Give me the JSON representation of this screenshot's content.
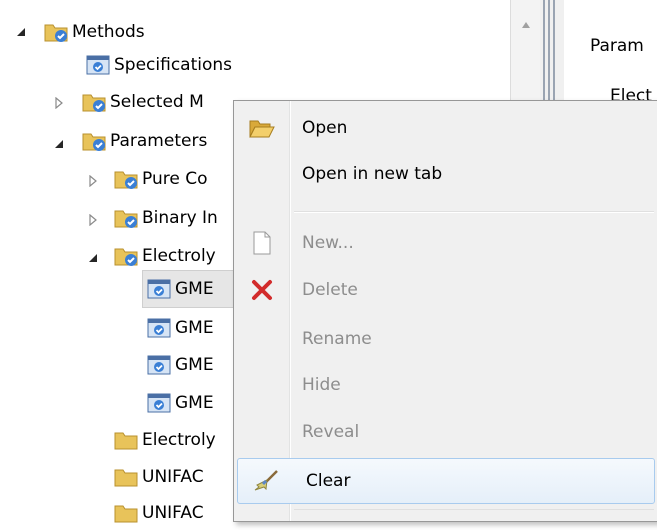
{
  "tree": {
    "items": [
      {
        "label": "Methods",
        "icon": "folder-gear-icon",
        "expander": "expanded"
      },
      {
        "label": "Specifications",
        "icon": "form-check-icon",
        "expander": "none"
      },
      {
        "label": "Selected M",
        "icon": "folder-gear-icon",
        "expander": "collapsed"
      },
      {
        "label": "Parameters",
        "icon": "folder-gear-icon",
        "expander": "expanded"
      },
      {
        "label": "Pure Co",
        "icon": "folder-gear-icon",
        "expander": "collapsed"
      },
      {
        "label": "Binary In",
        "icon": "folder-gear-icon",
        "expander": "collapsed"
      },
      {
        "label": "Electroly",
        "icon": "folder-gear-icon",
        "expander": "expanded"
      },
      {
        "label": "GME",
        "icon": "form-check-icon",
        "expander": "none"
      },
      {
        "label": "GME",
        "icon": "form-check-icon",
        "expander": "none"
      },
      {
        "label": "GME",
        "icon": "form-check-icon",
        "expander": "none"
      },
      {
        "label": "GME",
        "icon": "form-check-icon",
        "expander": "none"
      },
      {
        "label": "Electroly",
        "icon": "folder-icon",
        "expander": "none"
      },
      {
        "label": "UNIFAC",
        "icon": "folder-icon",
        "expander": "none"
      },
      {
        "label": "UNIFAC",
        "icon": "folder-icon",
        "expander": "none"
      }
    ]
  },
  "right_pane": {
    "text1": "Param",
    "text2": "Elect"
  },
  "context_menu": {
    "items": [
      {
        "label": "Open",
        "icon": "open-folder-icon",
        "enabled": true
      },
      {
        "label": "Open in new tab",
        "icon": "",
        "enabled": true
      },
      {
        "label": "New...",
        "icon": "new-document-icon",
        "enabled": false
      },
      {
        "label": "Delete",
        "icon": "delete-x-icon",
        "enabled": false
      },
      {
        "label": "Rename",
        "icon": "",
        "enabled": false
      },
      {
        "label": "Hide",
        "icon": "",
        "enabled": false
      },
      {
        "label": "Reveal",
        "icon": "",
        "enabled": false
      },
      {
        "label": "Clear",
        "icon": "broom-icon",
        "enabled": true,
        "highlighted": true
      }
    ]
  },
  "colors": {
    "folder": "#e8c35a",
    "gear_badge": "#3a7fd5",
    "delete": "#d22b2b",
    "disabled_text": "#8d8d8d",
    "hover_border": "#a8cbee"
  }
}
